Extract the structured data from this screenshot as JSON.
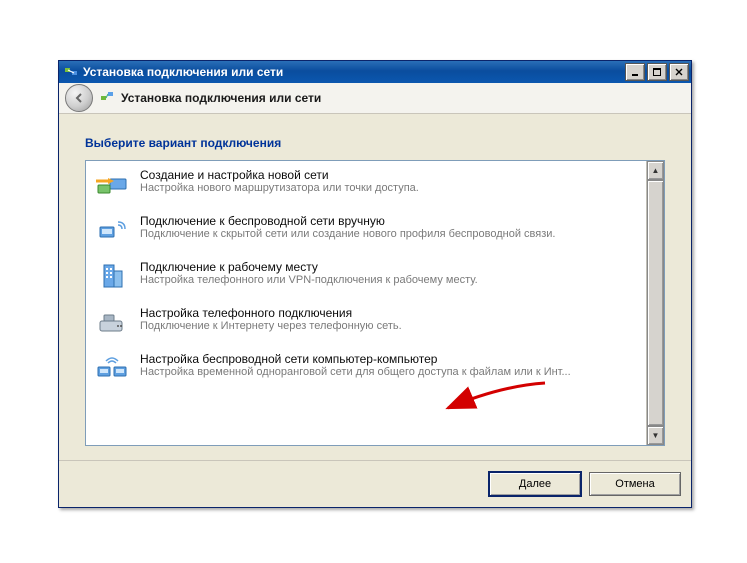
{
  "window": {
    "title": "Установка подключения или сети"
  },
  "header": {
    "title": "Установка подключения или сети"
  },
  "section_heading": "Выберите вариант подключения",
  "options": [
    {
      "title": "Создание и настройка новой сети",
      "desc": "Настройка нового маршрутизатора или точки доступа."
    },
    {
      "title": "Подключение к беспроводной сети вручную",
      "desc": "Подключение к скрытой сети или создание нового профиля беспроводной связи."
    },
    {
      "title": "Подключение к рабочему месту",
      "desc": "Настройка телефонного или VPN-подключения к рабочему месту."
    },
    {
      "title": "Настройка телефонного подключения",
      "desc": "Подключение к Интернету через телефонную сеть."
    },
    {
      "title": "Настройка беспроводной сети компьютер-компьютер",
      "desc": "Настройка временной одноранговой сети для общего доступа к файлам или к Инт..."
    }
  ],
  "buttons": {
    "next": "Далее",
    "cancel": "Отмена"
  }
}
